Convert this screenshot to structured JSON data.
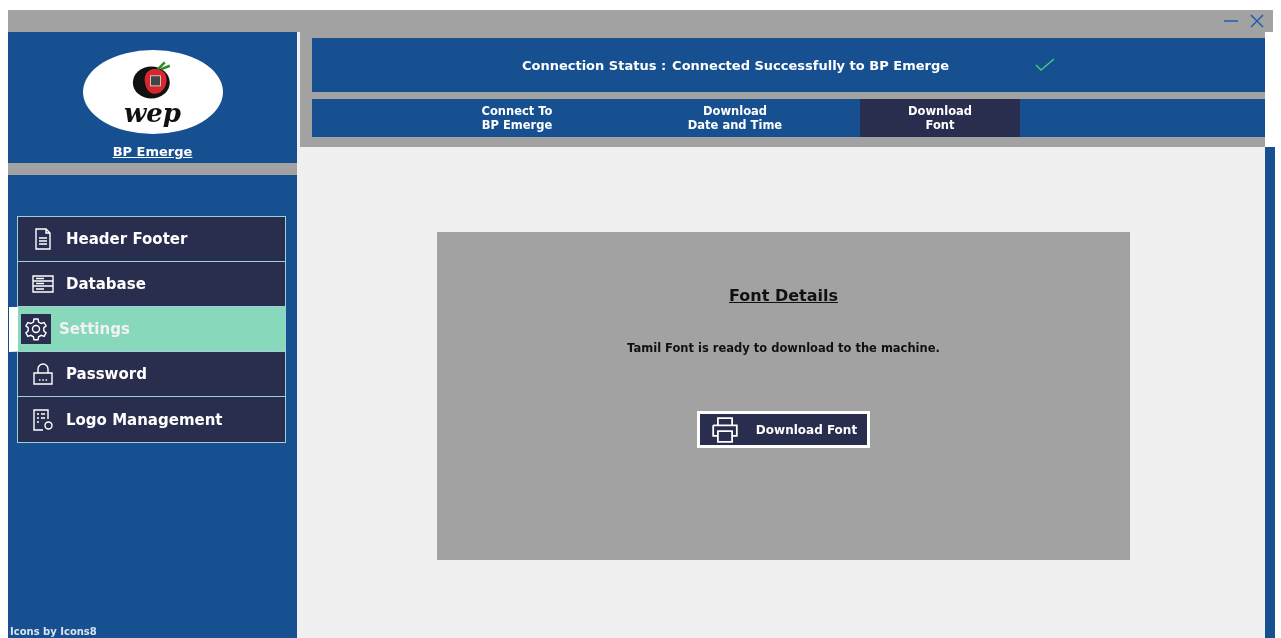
{
  "window": {
    "controls": [
      {
        "kind": "minimize"
      },
      {
        "kind": "close"
      }
    ]
  },
  "sidebar": {
    "logo_text": "wep",
    "app_name": "BP Emerge",
    "items": [
      {
        "label": "Header Footer",
        "kind": "document",
        "selected": false
      },
      {
        "label": "Database",
        "kind": "database",
        "selected": false
      },
      {
        "label": "Settings",
        "kind": "settings",
        "selected": true
      },
      {
        "label": "Password",
        "kind": "password",
        "selected": false
      },
      {
        "label": "Logo Management",
        "kind": "logo",
        "selected": false
      }
    ],
    "footer": "Icons by Icons8"
  },
  "status": {
    "label": "Connection Status :",
    "value": "Connected Successfully to BP Emerge",
    "connected": true
  },
  "tabs": [
    {
      "lines": [
        "Connect To",
        "BP Emerge"
      ],
      "selected": false
    },
    {
      "lines": [
        "Download",
        "Date and Time"
      ],
      "selected": false
    },
    {
      "lines": [
        "Download",
        "Font"
      ],
      "selected": true
    }
  ],
  "panel": {
    "title": "Font Details",
    "message": "Tamil Font is ready to download to the machine.",
    "button": "Download Font"
  }
}
